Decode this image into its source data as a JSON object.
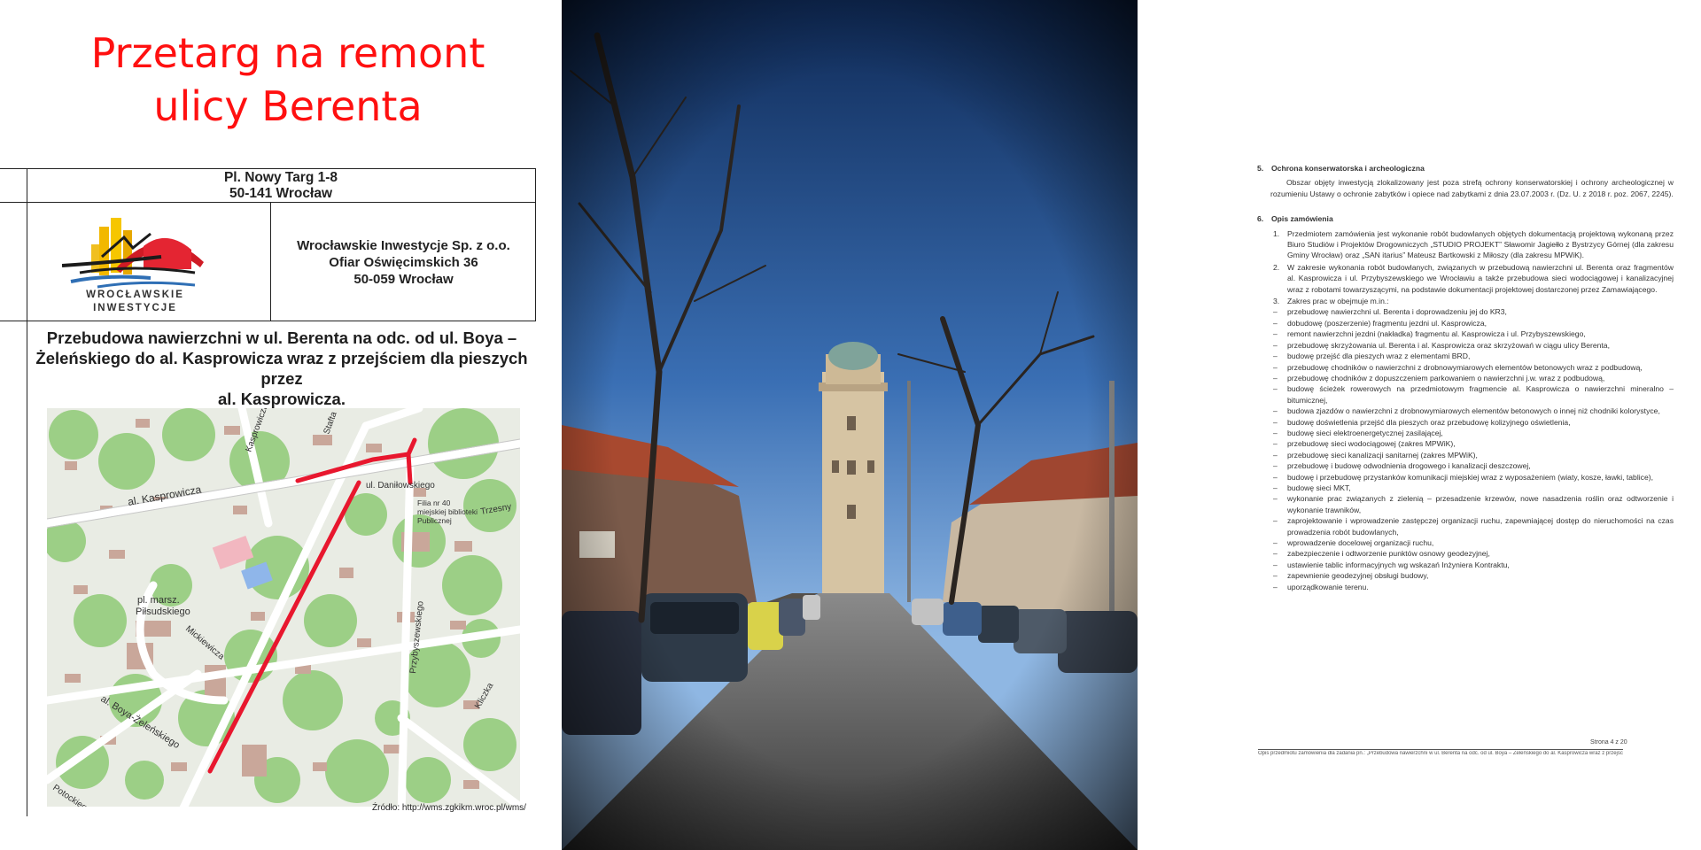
{
  "headline": {
    "line1": "Przetarg na remont",
    "line2": "ulicy Berenta",
    "color": "#ff1010"
  },
  "sheet": {
    "address": [
      "Pl. Nowy Targ 1-8",
      "50-141 Wrocław"
    ],
    "logo_text": [
      "WROCŁAWSKIE",
      "INWESTYCJE"
    ],
    "company": [
      "Wrocławskie Inwestycje Sp. z o.o.",
      "Ofiar Oświęcimskich 36",
      "50-059 Wrocław"
    ],
    "project": [
      "Przebudowa nawierzchni w ul. Berenta na odc. od ul. Boya –",
      "Żeleńskiego do al. Kasprowicza wraz z przejściem dla pieszych przez",
      "al. Kasprowicza."
    ],
    "map_labels": {
      "kasprowicza": "al. Kasprowicza",
      "daniłowskiego": "ul. Daniłowskiego",
      "filia": "Filia nr 40",
      "biblioteka1": "miejskiej biblioteki",
      "biblioteka2": "Publicznej",
      "zresny": "Trzesny",
      "pilsudskiego1": "pl. marsz.",
      "pilsudskiego2": "Piłsudskiego",
      "mickiewicza": "Mickiewicza",
      "przybyszewskiego": "Przybyszewskiego",
      "boya": "al. Boya-Żeleńskiego",
      "potockiego": "Potockiego",
      "kliczka": "Kliczka",
      "stafta": "Stafta",
      "kosciuszki": "Kasprowicza"
    },
    "source": "Źródło: http://wms.zgkikm.wroc.pl/wms/",
    "route_color": "#e8172e"
  },
  "doc": {
    "s5_num": "5.",
    "s5_title": "Ochrona konserwatorska i archeologiczna",
    "s5_text": "Obszar objęty inwestycją zlokalizowany jest poza strefą ochrony konserwatorskiej i ochrony archeologicznej w rozumieniu Ustawy o ochronie zabytków i opiece nad zabytkami z dnia 23.07.2003 r. (Dz. U. z 2018 r. poz. 2067, 2245).",
    "s6_num": "6.",
    "s6_title": "Opis zamówienia",
    "items": [
      {
        "n": "1.",
        "t": "Przedmiotem zamówienia jest wykonanie robót budowlanych objętych dokumentacją projektową wykonaną przez Biuro Studiów i Projektów Drogowniczych „STUDIO PROJEKT” Sławomir Jagiełło z Bystrzycy Górnej (dla zakresu Gminy Wrocław) oraz „SAN itarius” Mateusz Bartkowski z Miłoszy (dla zakresu MPWiK)."
      },
      {
        "n": "2.",
        "t": "W zakresie wykonania robót budowlanych, związanych w przebudową nawierzchni ul. Berenta oraz fragmentów al. Kasprowicza i ul. Przybyszewskiego we Wrocławiu a także przebudowa sieci wodociągowej i kanalizacyjnej wraz z robotami towarzyszącymi, na podstawie dokumentacji projektowej dostarczonej przez Zamawiającego."
      },
      {
        "n": "3.",
        "t": "Zakres prac w obejmuje m.in.:"
      }
    ],
    "bullets": [
      "przebudowę nawierzchni ul. Berenta i doprowadzeniu jej do KR3,",
      "dobudowę (poszerzenie) fragmentu jezdni ul. Kasprowicza,",
      "remont nawierzchni jezdni (nakładka) fragmentu al. Kasprowicza i ul. Przybyszewskiego,",
      "przebudowę skrzyżowania ul. Berenta i al. Kasprowicza oraz skrzyżowań w ciągu ulicy Berenta,",
      "budowę przejść dla pieszych wraz z elementami BRD,",
      "przebudowę chodników o nawierzchni z drobnowymiarowych elementów betonowych wraz z podbudową,",
      "przebudowę chodników z dopuszczeniem parkowaniem o nawierzchni j.w. wraz z podbudową,",
      "budowę ścieżek rowerowych na przedmiotowym fragmencie al. Kasprowicza o nawierzchni mineralno – bitumicznej,",
      "budowa zjazdów o nawierzchni z drobnowymiarowych elementów betonowych o innej niż chodniki kolorystyce,",
      "budowę doświetlenia przejść dla pieszych oraz przebudowę kolizyjnego oświetlenia,",
      "budowę sieci elektroenergetycznej zasilającej,",
      "przebudowę sieci wodociągowej (zakres MPWiK),",
      "przebudowę sieci kanalizacji sanitarnej (zakres MPWiK),",
      "przebudowę i budowę odwodnienia drogowego i kanalizacji deszczowej,",
      "budowę i przebudowę przystanków komunikacji miejskiej wraz z wyposażeniem (wiaty, kosze, ławki, tablice),",
      "budowę sieci MKT,",
      "wykonanie prac związanych z zielenią – przesadzenie krzewów, nowe nasadzenia roślin oraz odtworzenie i wykonanie trawników,",
      "zaprojektowanie i wprowadzenie zastępczej organizacji ruchu, zapewniającej dostęp do nieruchomości na czas prowadzenia robót budowlanych,",
      "wprowadzenie docelowej organizacji ruchu,",
      "zabezpieczenie i odtworzenie punktów osnowy geodezyjnej,",
      "ustawienie tablic informacyjnych wg wskazań Inżyniera Kontraktu,",
      "zapewnienie geodezyjnej obsługi budowy,",
      "uporządkowanie terenu."
    ],
    "dash": "–",
    "page": "Strona 4 z 20",
    "footer": "Opis przedmiotu zamówienia dla zadania pn.: „Przebudowa nawierzchni w ul. Berenta na odc. od ul. Boya – Żeleńskiego do al. Kasprowicza wraz z przejściem dla pieszych przez al. Kasprowicza”"
  }
}
